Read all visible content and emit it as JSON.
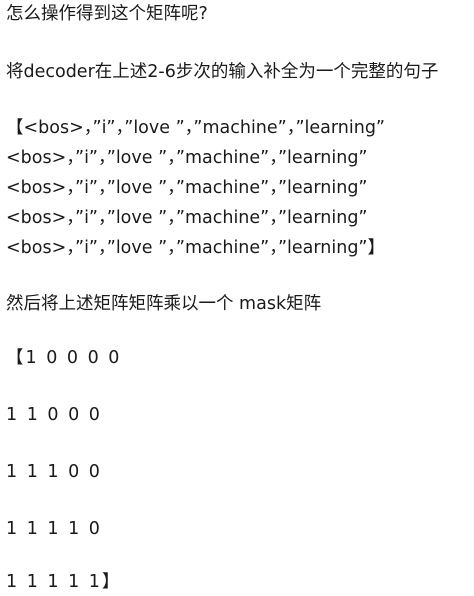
{
  "question": "怎么操作得到这个矩阵呢?",
  "instruction": "将decoder在上述2-6步次的输入补全为一个完整的句子",
  "input_matrix_rows": [
    "【<bos>，”i”，”love ”，”machine”，”learning”",
    "<bos>，”i”，”love ”，”machine”，”learning”",
    "<bos>，”i”，”love ”，”machine”，”learning”",
    "<bos>，”i”，”love ”，”machine”，”learning”",
    "<bos>，”i”，”love ”，”machine”，”learning”】"
  ],
  "mask_instruction": "然后将上述矩阵矩阵乘以一个 mask矩阵",
  "mask_matrix_rows": [
    "【1 0 0 0 0",
    "1 1 0 0 0",
    "1 1 1 0 0",
    "1 1 1 1 0",
    "1 1 1 1 1】"
  ]
}
